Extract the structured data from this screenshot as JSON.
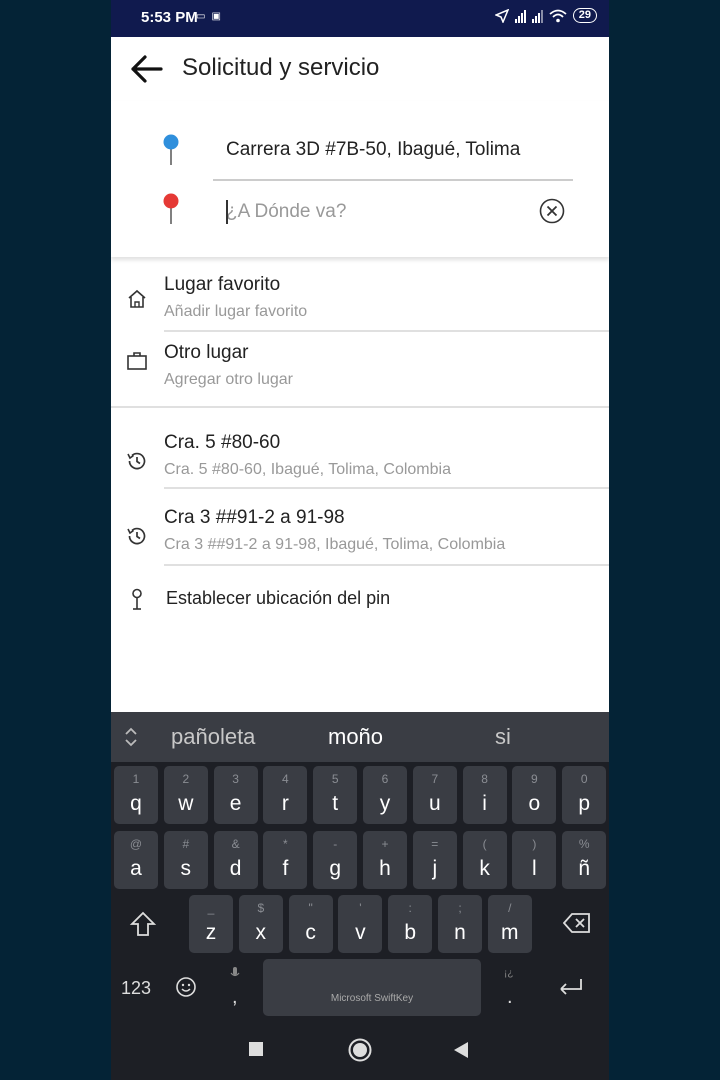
{
  "status": {
    "time": "5:53 PM",
    "battery": "29"
  },
  "header": {
    "title": "Solicitud y servicio"
  },
  "route": {
    "origin": "Carrera 3D #7B-50, Ibagué, Tolima",
    "destination_placeholder": "¿A Dónde va?"
  },
  "list": {
    "favorite": {
      "title": "Lugar favorito",
      "subtitle": "Añadir lugar favorito"
    },
    "other": {
      "title": "Otro lugar",
      "subtitle": "Agregar otro lugar"
    },
    "recent": [
      {
        "title": "Cra. 5 #80-60",
        "subtitle": "Cra. 5 #80-60, Ibagué, Tolima, Colombia"
      },
      {
        "title": "Cra 3 ##91-2 a 91-98",
        "subtitle": "Cra 3 ##91-2 a 91-98, Ibagué, Tolima, Colombia"
      }
    ],
    "set_pin": "Establecer ubicación del pin"
  },
  "keyboard": {
    "suggestions": [
      "pañoleta",
      "moño",
      "si"
    ],
    "row1": [
      {
        "p": "q",
        "s": "1"
      },
      {
        "p": "w",
        "s": "2"
      },
      {
        "p": "e",
        "s": "3"
      },
      {
        "p": "r",
        "s": "4"
      },
      {
        "p": "t",
        "s": "5"
      },
      {
        "p": "y",
        "s": "6"
      },
      {
        "p": "u",
        "s": "7"
      },
      {
        "p": "i",
        "s": "8"
      },
      {
        "p": "o",
        "s": "9"
      },
      {
        "p": "p",
        "s": "0"
      }
    ],
    "row2": [
      {
        "p": "a",
        "s": "@"
      },
      {
        "p": "s",
        "s": "#"
      },
      {
        "p": "d",
        "s": "&"
      },
      {
        "p": "f",
        "s": "*"
      },
      {
        "p": "g",
        "s": "-"
      },
      {
        "p": "h",
        "s": "+"
      },
      {
        "p": "j",
        "s": "="
      },
      {
        "p": "k",
        "s": "("
      },
      {
        "p": "l",
        "s": ")"
      },
      {
        "p": "ñ",
        "s": "%"
      }
    ],
    "row3": [
      {
        "p": "z",
        "s": "_"
      },
      {
        "p": "x",
        "s": "$"
      },
      {
        "p": "c",
        "s": "\""
      },
      {
        "p": "v",
        "s": "'"
      },
      {
        "p": "b",
        "s": ":"
      },
      {
        "p": "n",
        "s": ";"
      },
      {
        "p": "m",
        "s": "/"
      }
    ],
    "numbers_key": "123",
    "comma": ",",
    "period": ".",
    "period_sec": "¡¿",
    "space_label": "Microsoft SwiftKey"
  },
  "colors": {
    "statusbar": "#101a4e",
    "pin_origin": "#2f8fdc",
    "pin_destination": "#e53935",
    "keyboard": "#1d1f25",
    "key": "#3a3d44"
  }
}
